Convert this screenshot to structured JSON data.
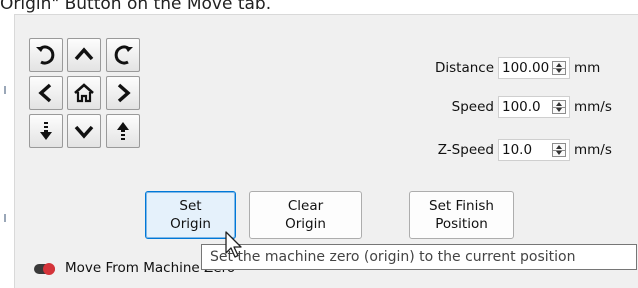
{
  "caption": "Origin\" Button on the Move tab.",
  "jog_buttons": [
    {
      "name": "rotate-ccw-button",
      "icon": "rotate-counterclockwise-icon"
    },
    {
      "name": "move-up-button",
      "icon": "chevron-up-icon"
    },
    {
      "name": "rotate-cw-button",
      "icon": "rotate-clockwise-icon"
    },
    {
      "name": "move-left-button",
      "icon": "chevron-left-icon"
    },
    {
      "name": "home-button",
      "icon": "home-icon"
    },
    {
      "name": "move-right-button",
      "icon": "chevron-right-icon"
    },
    {
      "name": "z-down-button",
      "icon": "z-down-arrow-icon"
    },
    {
      "name": "move-down-button",
      "icon": "chevron-down-icon"
    },
    {
      "name": "z-up-button",
      "icon": "z-up-arrow-icon"
    }
  ],
  "fields": {
    "distance": {
      "label": "Distance",
      "value": "100.00",
      "unit": "mm"
    },
    "speed": {
      "label": "Speed",
      "value": "100.0",
      "unit": "mm/s"
    },
    "z_speed": {
      "label": "Z-Speed",
      "value": "10.0",
      "unit": "mm/s"
    }
  },
  "actions": {
    "set_origin": {
      "line1": "Set",
      "line2": "Origin"
    },
    "clear_origin": {
      "line1": "Clear",
      "line2": "Origin"
    },
    "set_finish": {
      "line1": "Set Finish",
      "line2": "Position"
    }
  },
  "toggle": {
    "label": "Move From Machine Zero",
    "state": "off",
    "knob_color": "#d4343a"
  },
  "tooltip": {
    "text": "Set the machine zero (origin) to the current position"
  },
  "colors": {
    "panel_bg": "#f0f0f0",
    "hover_accent": "#0078d7",
    "hover_fill": "#e5f1fb"
  }
}
